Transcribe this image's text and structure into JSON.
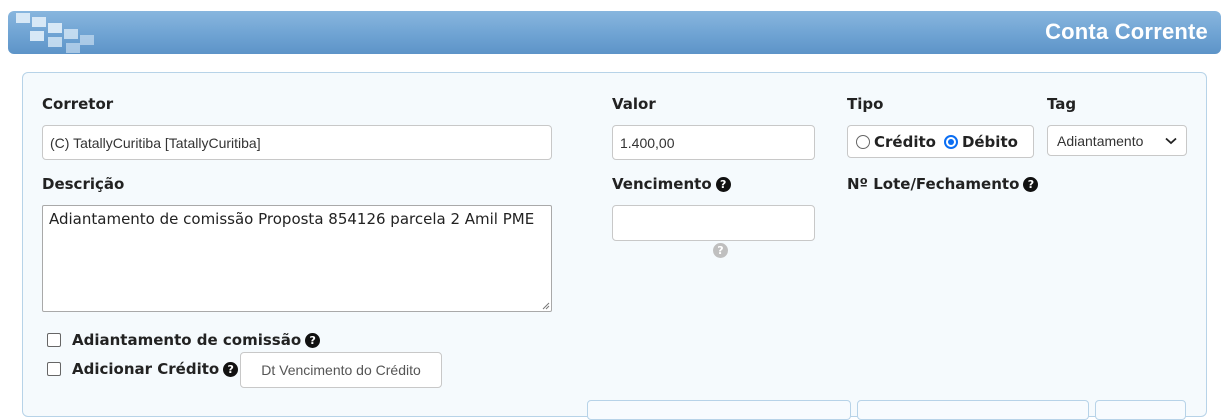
{
  "header": {
    "title": "Conta Corrente"
  },
  "form": {
    "corretor": {
      "label": "Corretor",
      "value": "(C) TatallyCuritiba [TatallyCuritiba]"
    },
    "valor": {
      "label": "Valor",
      "value": "1.400,00"
    },
    "tipo": {
      "label": "Tipo",
      "options": [
        {
          "label": "Crédito",
          "selected": false
        },
        {
          "label": "Débito",
          "selected": true
        }
      ]
    },
    "tag": {
      "label": "Tag",
      "selected": "Adiantamento"
    },
    "descricao": {
      "label": "Descrição",
      "value": "Adiantamento de comissão Proposta 854126 parcela 2 Amil PME"
    },
    "vencimento": {
      "label": "Vencimento",
      "value": ""
    },
    "lote": {
      "label": "Nº Lote/Fechamento"
    },
    "adiantamento_comissao": {
      "label": "Adiantamento de comissão",
      "checked": false
    },
    "adicionar_credito": {
      "label": "Adicionar Crédito",
      "checked": false,
      "button_label": "Dt Vencimento do Crédito"
    }
  },
  "icons": {
    "help": "question-circle-icon",
    "dropdown": "chevron-down-icon"
  },
  "colors": {
    "header": "#6fa3d3",
    "radio_selected": "#0b6ef3",
    "panel_border": "#b7d3e8"
  }
}
